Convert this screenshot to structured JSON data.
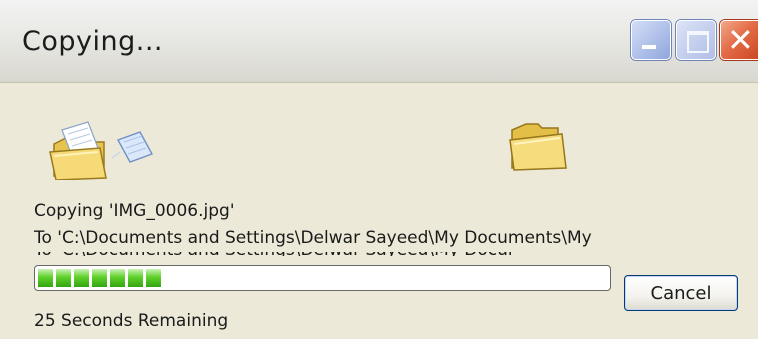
{
  "window": {
    "title": "Copying...",
    "minimize_icon": "minimize-icon",
    "maximize_icon": "maximize-icon",
    "close_icon": "close-icon",
    "close_glyph": "✕"
  },
  "icons": {
    "source": "source-folder-with-flying-paper-icon",
    "destination": "destination-folder-icon"
  },
  "status": {
    "copying_line": "Copying 'IMG_0006.jpg'",
    "to_line": "To 'C:\\Documents and Settings\\Delwar Sayeed\\My Documents\\My",
    "remaining": "25 Seconds Remaining"
  },
  "progress": {
    "segments_filled": 7,
    "segment_color": "#4cc21f"
  },
  "buttons": {
    "cancel_label": "Cancel"
  }
}
